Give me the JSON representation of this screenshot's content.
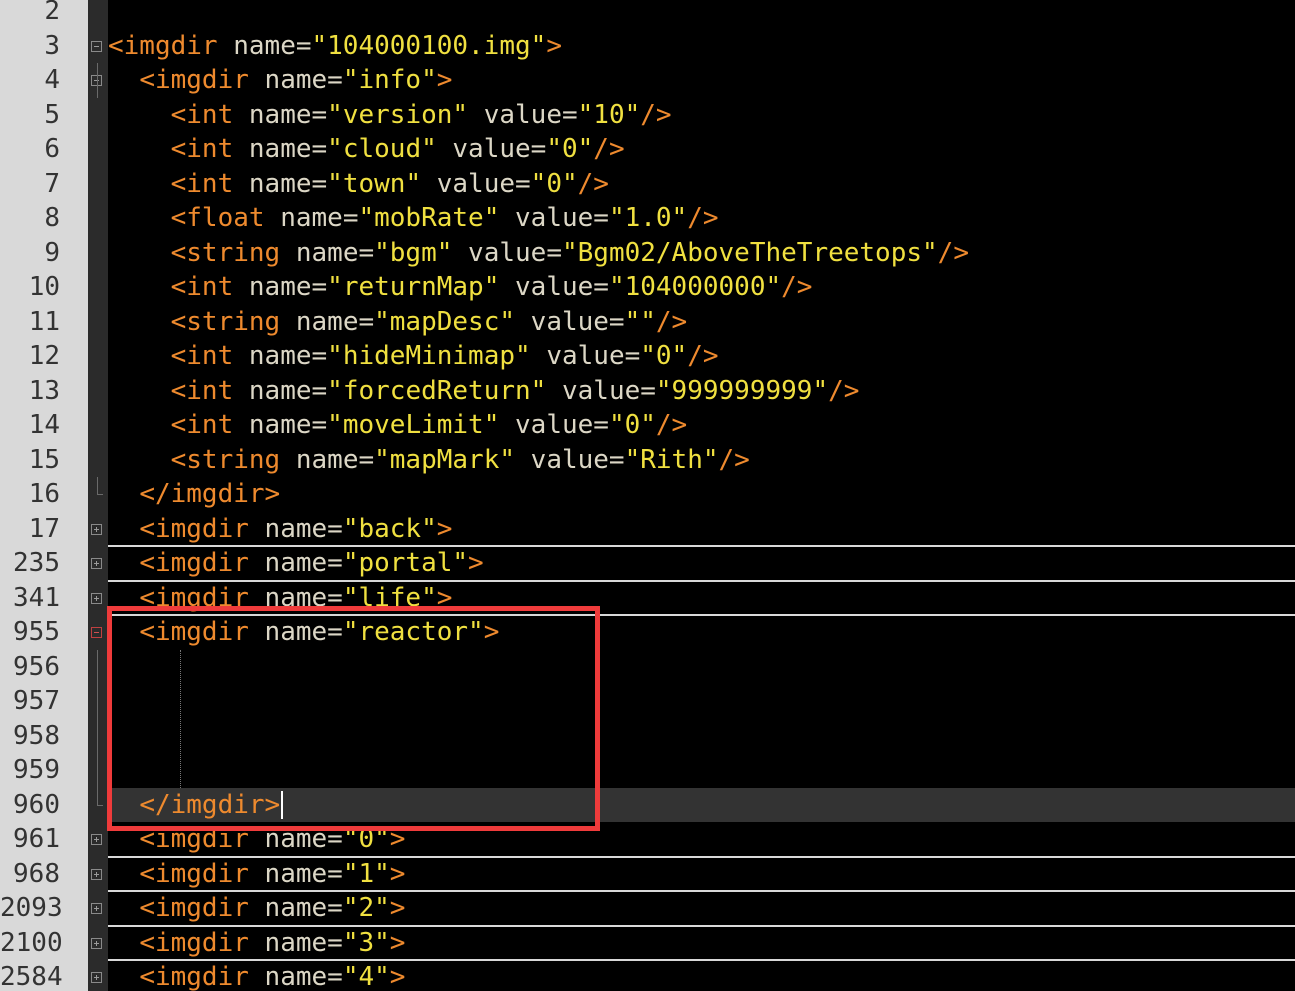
{
  "editor": {
    "lines": [
      {
        "num": "2",
        "indent": 0,
        "fold": "",
        "parts": []
      },
      {
        "num": "3",
        "indent": 0,
        "fold": "minus",
        "parts": [
          {
            "t": "tag",
            "v": "<imgdir"
          },
          {
            "t": "attr",
            "v": " name="
          },
          {
            "t": "val",
            "v": "\"104000100.img\""
          },
          {
            "t": "tag",
            "v": ">"
          }
        ]
      },
      {
        "num": "4",
        "indent": 2,
        "fold": "minus",
        "parts": [
          {
            "t": "tag",
            "v": "<imgdir"
          },
          {
            "t": "attr",
            "v": " name="
          },
          {
            "t": "val",
            "v": "\"info\""
          },
          {
            "t": "tag",
            "v": ">"
          }
        ]
      },
      {
        "num": "5",
        "indent": 4,
        "fold": "",
        "parts": [
          {
            "t": "tag",
            "v": "<int"
          },
          {
            "t": "attr",
            "v": " name="
          },
          {
            "t": "val",
            "v": "\"version\""
          },
          {
            "t": "attr",
            "v": " value="
          },
          {
            "t": "val",
            "v": "\"10\""
          },
          {
            "t": "tag",
            "v": "/>"
          }
        ]
      },
      {
        "num": "6",
        "indent": 4,
        "fold": "",
        "parts": [
          {
            "t": "tag",
            "v": "<int"
          },
          {
            "t": "attr",
            "v": " name="
          },
          {
            "t": "val",
            "v": "\"cloud\""
          },
          {
            "t": "attr",
            "v": " value="
          },
          {
            "t": "val",
            "v": "\"0\""
          },
          {
            "t": "tag",
            "v": "/>"
          }
        ]
      },
      {
        "num": "7",
        "indent": 4,
        "fold": "",
        "parts": [
          {
            "t": "tag",
            "v": "<int"
          },
          {
            "t": "attr",
            "v": " name="
          },
          {
            "t": "val",
            "v": "\"town\""
          },
          {
            "t": "attr",
            "v": " value="
          },
          {
            "t": "val",
            "v": "\"0\""
          },
          {
            "t": "tag",
            "v": "/>"
          }
        ]
      },
      {
        "num": "8",
        "indent": 4,
        "fold": "",
        "parts": [
          {
            "t": "tag",
            "v": "<float"
          },
          {
            "t": "attr",
            "v": " name="
          },
          {
            "t": "val",
            "v": "\"mobRate\""
          },
          {
            "t": "attr",
            "v": " value="
          },
          {
            "t": "val",
            "v": "\"1.0\""
          },
          {
            "t": "tag",
            "v": "/>"
          }
        ]
      },
      {
        "num": "9",
        "indent": 4,
        "fold": "",
        "parts": [
          {
            "t": "tag",
            "v": "<string"
          },
          {
            "t": "attr",
            "v": " name="
          },
          {
            "t": "val",
            "v": "\"bgm\""
          },
          {
            "t": "attr",
            "v": " value="
          },
          {
            "t": "val",
            "v": "\"Bgm02/AboveTheTreetops\""
          },
          {
            "t": "tag",
            "v": "/>"
          }
        ]
      },
      {
        "num": "10",
        "indent": 4,
        "fold": "",
        "parts": [
          {
            "t": "tag",
            "v": "<int"
          },
          {
            "t": "attr",
            "v": " name="
          },
          {
            "t": "val",
            "v": "\"returnMap\""
          },
          {
            "t": "attr",
            "v": " value="
          },
          {
            "t": "val",
            "v": "\"104000000\""
          },
          {
            "t": "tag",
            "v": "/>"
          }
        ]
      },
      {
        "num": "11",
        "indent": 4,
        "fold": "",
        "parts": [
          {
            "t": "tag",
            "v": "<string"
          },
          {
            "t": "attr",
            "v": " name="
          },
          {
            "t": "val",
            "v": "\"mapDesc\""
          },
          {
            "t": "attr",
            "v": " value="
          },
          {
            "t": "val",
            "v": "\"\""
          },
          {
            "t": "tag",
            "v": "/>"
          }
        ]
      },
      {
        "num": "12",
        "indent": 4,
        "fold": "",
        "parts": [
          {
            "t": "tag",
            "v": "<int"
          },
          {
            "t": "attr",
            "v": " name="
          },
          {
            "t": "val",
            "v": "\"hideMinimap\""
          },
          {
            "t": "attr",
            "v": " value="
          },
          {
            "t": "val",
            "v": "\"0\""
          },
          {
            "t": "tag",
            "v": "/>"
          }
        ]
      },
      {
        "num": "13",
        "indent": 4,
        "fold": "",
        "parts": [
          {
            "t": "tag",
            "v": "<int"
          },
          {
            "t": "attr",
            "v": " name="
          },
          {
            "t": "val",
            "v": "\"forcedReturn\""
          },
          {
            "t": "attr",
            "v": " value="
          },
          {
            "t": "val",
            "v": "\"999999999\""
          },
          {
            "t": "tag",
            "v": "/>"
          }
        ]
      },
      {
        "num": "14",
        "indent": 4,
        "fold": "",
        "parts": [
          {
            "t": "tag",
            "v": "<int"
          },
          {
            "t": "attr",
            "v": " name="
          },
          {
            "t": "val",
            "v": "\"moveLimit\""
          },
          {
            "t": "attr",
            "v": " value="
          },
          {
            "t": "val",
            "v": "\"0\""
          },
          {
            "t": "tag",
            "v": "/>"
          }
        ]
      },
      {
        "num": "15",
        "indent": 4,
        "fold": "",
        "parts": [
          {
            "t": "tag",
            "v": "<string"
          },
          {
            "t": "attr",
            "v": " name="
          },
          {
            "t": "val",
            "v": "\"mapMark\""
          },
          {
            "t": "attr",
            "v": " value="
          },
          {
            "t": "val",
            "v": "\"Rith\""
          },
          {
            "t": "tag",
            "v": "/>"
          }
        ]
      },
      {
        "num": "16",
        "indent": 2,
        "fold": "end",
        "parts": [
          {
            "t": "tag",
            "v": "</imgdir>"
          }
        ]
      },
      {
        "num": "17",
        "indent": 2,
        "fold": "plus",
        "sep": true,
        "parts": [
          {
            "t": "tag",
            "v": "<imgdir"
          },
          {
            "t": "attr",
            "v": " name="
          },
          {
            "t": "val",
            "v": "\"back\""
          },
          {
            "t": "tag",
            "v": ">"
          }
        ]
      },
      {
        "num": "235",
        "indent": 2,
        "fold": "plus",
        "sep": true,
        "parts": [
          {
            "t": "tag",
            "v": "<imgdir"
          },
          {
            "t": "attr",
            "v": " name="
          },
          {
            "t": "val",
            "v": "\"portal\""
          },
          {
            "t": "tag",
            "v": ">"
          }
        ]
      },
      {
        "num": "341",
        "indent": 2,
        "fold": "plus",
        "sep": true,
        "parts": [
          {
            "t": "tag",
            "v": "<imgdir"
          },
          {
            "t": "attr",
            "v": " name="
          },
          {
            "t": "val",
            "v": "\"life\""
          },
          {
            "t": "tag",
            "v": ">"
          }
        ]
      },
      {
        "num": "955",
        "indent": 2,
        "fold": "active",
        "parts": [
          {
            "t": "tag",
            "v": "<imgdir"
          },
          {
            "t": "attr",
            "v": " name="
          },
          {
            "t": "val",
            "v": "\"reactor\""
          },
          {
            "t": "tag",
            "v": ">"
          }
        ]
      },
      {
        "num": "956",
        "indent": 0,
        "fold": "line",
        "parts": []
      },
      {
        "num": "957",
        "indent": 0,
        "fold": "line",
        "parts": []
      },
      {
        "num": "958",
        "indent": 0,
        "fold": "line",
        "parts": []
      },
      {
        "num": "959",
        "indent": 0,
        "fold": "line",
        "parts": []
      },
      {
        "num": "960",
        "indent": 2,
        "fold": "end",
        "current": true,
        "caret": true,
        "parts": [
          {
            "t": "tag",
            "v": "</imgdir>"
          }
        ]
      },
      {
        "num": "961",
        "indent": 2,
        "fold": "plus",
        "sep": true,
        "parts": [
          {
            "t": "tag",
            "v": "<imgdir"
          },
          {
            "t": "attr",
            "v": " name="
          },
          {
            "t": "val",
            "v": "\"0\""
          },
          {
            "t": "tag",
            "v": ">"
          }
        ]
      },
      {
        "num": "968",
        "indent": 2,
        "fold": "plus",
        "sep": true,
        "parts": [
          {
            "t": "tag",
            "v": "<imgdir"
          },
          {
            "t": "attr",
            "v": " name="
          },
          {
            "t": "val",
            "v": "\"1\""
          },
          {
            "t": "tag",
            "v": ">"
          }
        ]
      },
      {
        "num": "2093",
        "indent": 2,
        "fold": "plus",
        "sep": true,
        "parts": [
          {
            "t": "tag",
            "v": "<imgdir"
          },
          {
            "t": "attr",
            "v": " name="
          },
          {
            "t": "val",
            "v": "\"2\""
          },
          {
            "t": "tag",
            "v": ">"
          }
        ]
      },
      {
        "num": "2100",
        "indent": 2,
        "fold": "plus",
        "sep": true,
        "parts": [
          {
            "t": "tag",
            "v": "<imgdir"
          },
          {
            "t": "attr",
            "v": " name="
          },
          {
            "t": "val",
            "v": "\"3\""
          },
          {
            "t": "tag",
            "v": ">"
          }
        ]
      },
      {
        "num": "2584",
        "indent": 2,
        "fold": "plus",
        "parts": [
          {
            "t": "tag",
            "v": "<imgdir"
          },
          {
            "t": "attr",
            "v": " name="
          },
          {
            "t": "val",
            "v": "\"4\""
          },
          {
            "t": "tag",
            "v": ">"
          }
        ]
      }
    ]
  },
  "colors": {
    "tag": "#ee8a2e",
    "attr": "#dcd7c6",
    "value": "#f0e040",
    "background": "#000000",
    "gutter": "#d9d9d9",
    "highlight": "#ef3b3b"
  }
}
